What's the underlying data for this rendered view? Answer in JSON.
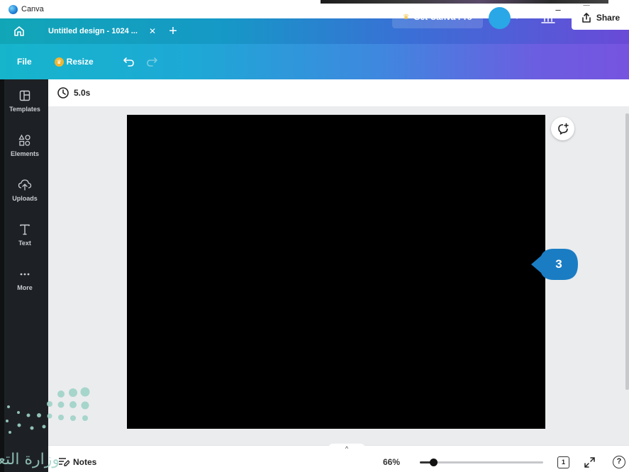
{
  "window": {
    "app_title": "Canva",
    "controls": {
      "minimize": "–",
      "maximize": "☐",
      "close": "✕"
    }
  },
  "tabs": {
    "home_icon": "home-icon",
    "doc_tab_label": "Untitled design - 1024 ...",
    "doc_tab_close": "✕",
    "new_tab": "+"
  },
  "toolbar": {
    "file_label": "File",
    "resize_label": "Resize",
    "pro_label": "Get Canva Pro",
    "plus_label": "+",
    "share_label": "Share"
  },
  "sidebar": {
    "items": [
      {
        "label": "Templates",
        "icon": "templates-icon"
      },
      {
        "label": "Elements",
        "icon": "elements-icon"
      },
      {
        "label": "Uploads",
        "icon": "uploads-icon"
      },
      {
        "label": "Text",
        "icon": "text-icon"
      },
      {
        "label": "More",
        "icon": "more-icon"
      }
    ]
  },
  "timing": {
    "duration": "5.0s"
  },
  "canvas": {
    "background": "#000000"
  },
  "callout": {
    "number": "3",
    "color": "#1a7dc4"
  },
  "bottom": {
    "notes_label": "Notes",
    "zoom_value": "66%",
    "zoom_fraction": 0.11,
    "page_number": "1",
    "help_label": "?",
    "hide_pages_label": "^"
  },
  "watermark": {
    "text": "وزارة التعليم"
  },
  "colors": {
    "tab_gradient_start": "#11a6b7",
    "tab_gradient_end": "#6a4ad8",
    "sidebar_bg": "#1d2126",
    "workarea_bg": "#ebecee"
  }
}
